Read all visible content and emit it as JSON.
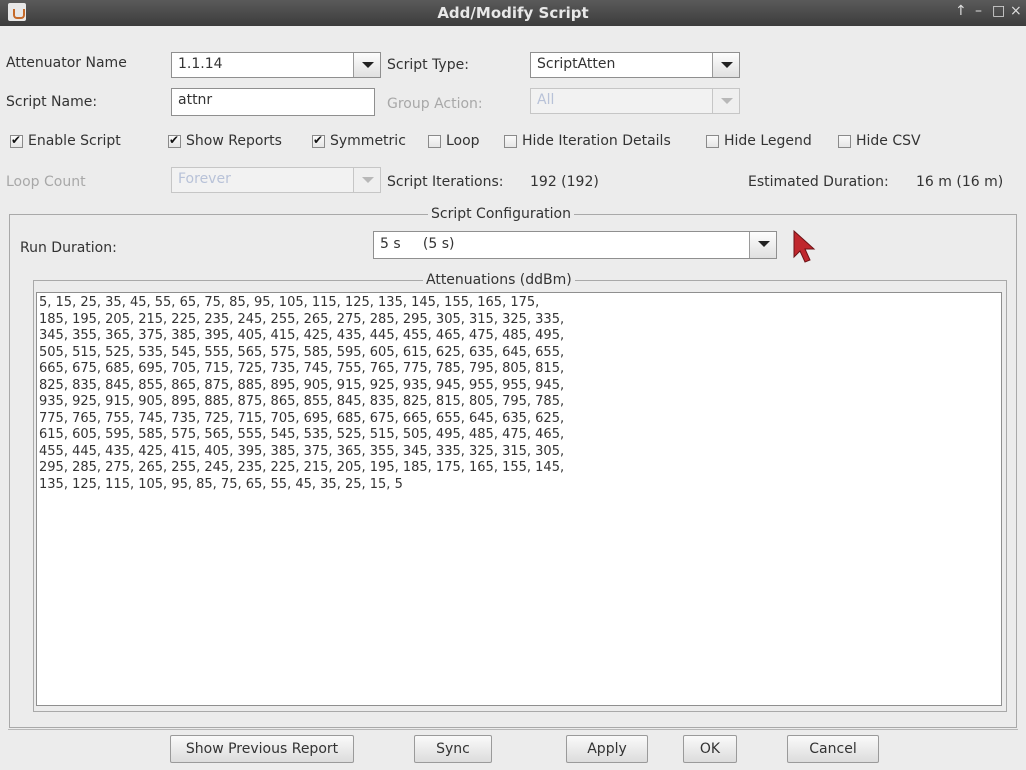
{
  "window": {
    "title": "Add/Modify Script",
    "controls": [
      "↑",
      "–",
      "□",
      "×"
    ]
  },
  "fields": {
    "attenuator_name_label": "Attenuator Name",
    "attenuator_name_value": "1.1.14",
    "script_type_label": "Script Type:",
    "script_type_value": "ScriptAtten",
    "script_name_label": "Script Name:",
    "script_name_value": "attnr",
    "group_action_label": "Group Action:",
    "group_action_value": "All",
    "loop_count_label": "Loop Count",
    "loop_count_value": "Forever",
    "script_iterations_label": "Script Iterations:",
    "script_iterations_value": "192 (192)",
    "estimated_duration_label": "Estimated Duration:",
    "estimated_duration_value": "16 m (16 m)"
  },
  "checkboxes": [
    {
      "label": "Enable Script",
      "checked": true
    },
    {
      "label": "Show Reports",
      "checked": true
    },
    {
      "label": "Symmetric",
      "checked": true
    },
    {
      "label": "Loop",
      "checked": false
    },
    {
      "label": "Hide Iteration Details",
      "checked": false
    },
    {
      "label": "Hide Legend",
      "checked": false
    },
    {
      "label": "Hide CSV",
      "checked": false
    }
  ],
  "config": {
    "title": "Script Configuration",
    "run_duration_label": "Run Duration:",
    "run_duration_value": "5 s     (5 s)",
    "attenuations_title": "Attenuations (ddBm)",
    "attenuation_lines": [
      "5, 15, 25, 35, 45, 55, 65, 75, 85, 95, 105, 115, 125, 135, 145, 155, 165, 175,",
      "185, 195, 205, 215, 225, 235, 245, 255, 265, 275, 285, 295, 305, 315, 325, 335,",
      "345, 355, 365, 375, 385, 395, 405, 415, 425, 435, 445, 455, 465, 475, 485, 495,",
      "505, 515, 525, 535, 545, 555, 565, 575, 585, 595, 605, 615, 625, 635, 645, 655,",
      "665, 675, 685, 695, 705, 715, 725, 735, 745, 755, 765, 775, 785, 795, 805, 815,",
      "825, 835, 845, 855, 865, 875, 885, 895, 905, 915, 925, 935, 945, 955, 955, 945,",
      "935, 925, 915, 905, 895, 885, 875, 865, 855, 845, 835, 825, 815, 805, 795, 785,",
      "775, 765, 755, 745, 735, 725, 715, 705, 695, 685, 675, 665, 655, 645, 635, 625,",
      "615, 605, 595, 585, 575, 565, 555, 545, 535, 525, 515, 505, 495, 485, 475, 465,",
      "455, 445, 435, 425, 415, 405, 395, 385, 375, 365, 355, 345, 335, 325, 315, 305,",
      "295, 285, 275, 265, 255, 245, 235, 225, 215, 205, 195, 185, 175, 165, 155, 145,",
      "135, 125, 115, 105, 95, 85, 75, 65, 55, 45, 35, 25, 15, 5"
    ]
  },
  "buttons": {
    "show_previous_report": "Show Previous Report",
    "sync": "Sync",
    "apply": "Apply",
    "ok": "OK",
    "cancel": "Cancel"
  },
  "colors": {
    "titlebar": "#4a4a4a",
    "pointer": "#c0272d"
  }
}
